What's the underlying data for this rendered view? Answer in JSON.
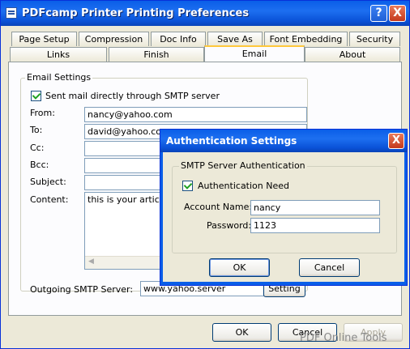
{
  "window": {
    "title": "PDFcamp Printer Printing Preferences",
    "help_glyph": "?",
    "close_glyph": "X"
  },
  "tabs_top": [
    "Page Setup",
    "Compression",
    "Doc Info",
    "Save As",
    "Font Embedding",
    "Security"
  ],
  "tabs_bottom": [
    "Links",
    "Finish",
    "Email",
    "About"
  ],
  "active_tab": "Email",
  "email_settings": {
    "group_label": "Email Settings",
    "smtp_checkbox_label": "Sent mail directly through SMTP server",
    "from_label": "From:",
    "from_value": "nancy@yahoo.com",
    "to_label": "To:",
    "to_value": "david@yahoo.com",
    "cc_label": "Cc:",
    "cc_value": "",
    "bcc_label": "Bcc:",
    "bcc_value": "",
    "subject_label": "Subject:",
    "subject_value": "",
    "content_label": "Content:",
    "content_value": "this is your article.",
    "smtp_server_label": "Outgoing SMTP Server:",
    "smtp_server_value": "www.yahoo.server",
    "setting_button": "Setting"
  },
  "auth_dialog": {
    "title": "Authentication Settings",
    "group_label": "SMTP Server Authentication",
    "auth_checkbox_label": "Authentication Need",
    "account_label": "Account Name:",
    "account_value": "nancy",
    "password_label": "Password:",
    "password_value": "1123",
    "ok": "OK",
    "cancel": "Cancel",
    "close_glyph": "X"
  },
  "buttons": {
    "ok": "OK",
    "cancel": "Cancel",
    "apply": "Apply"
  },
  "watermark": "PDF Online Tools"
}
